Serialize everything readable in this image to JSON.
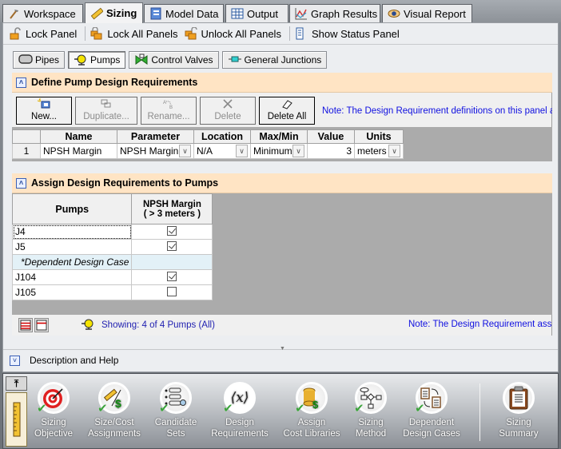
{
  "tabs": [
    {
      "label": "Workspace",
      "icon": "hammer-icon",
      "active": false
    },
    {
      "label": "Sizing",
      "icon": "ruler-icon",
      "active": true
    },
    {
      "label": "Model Data",
      "icon": "notebook-icon",
      "active": false
    },
    {
      "label": "Output",
      "icon": "table-icon",
      "active": false
    },
    {
      "label": "Graph Results",
      "icon": "graph-icon",
      "active": false
    },
    {
      "label": "Visual Report",
      "icon": "eye-icon",
      "active": false
    }
  ],
  "toolbar": {
    "lock_panel": "Lock Panel",
    "lock_all": "Lock All Panels",
    "unlock_all": "Unlock All Panels",
    "show_status": "Show Status Panel"
  },
  "subtabs": [
    {
      "label": "Pipes",
      "icon": "pipe-icon",
      "active": false
    },
    {
      "label": "Pumps",
      "icon": "pump-icon",
      "active": true
    },
    {
      "label": "Control Valves",
      "icon": "valve-icon",
      "active": false
    },
    {
      "label": "General Junctions",
      "icon": "junction-icon",
      "active": false
    }
  ],
  "define_panel": {
    "title": "Define Pump Design Requirements",
    "buttons": {
      "new": "New...",
      "duplicate": "Duplicate...",
      "rename": "Rename...",
      "delete": "Delete",
      "delete_all": "Delete All"
    },
    "note": "Note: The Design Requirement definitions on this panel are co",
    "columns": [
      "Name",
      "Parameter",
      "Location",
      "Max/Min",
      "Value",
      "Units"
    ],
    "rows": [
      {
        "index": "1",
        "name": "NPSH Margin",
        "parameter": "NPSH Margin",
        "location": "N/A",
        "maxmin": "Minimum",
        "value": "3",
        "units": "meters"
      }
    ]
  },
  "assign_panel": {
    "title": "Assign Design Requirements to Pumps",
    "col_pumps": "Pumps",
    "col_req_line1": "NPSH Margin",
    "col_req_line2": "( > 3 meters )",
    "rows": [
      {
        "name": "J4",
        "checked": true
      },
      {
        "name": "J5",
        "checked": true
      },
      {
        "name": "*Dependent Design Case",
        "section": true
      },
      {
        "name": "J104",
        "checked": true
      },
      {
        "name": "J105",
        "checked": false
      }
    ],
    "showing": "Showing: 4 of 4 Pumps (All)",
    "note": "Note: The Design Requirement assig"
  },
  "description_help": "Description and Help",
  "ribbon": {
    "items": [
      {
        "line1": "Sizing",
        "line2": "Objective",
        "icon": "target-icon",
        "done": true
      },
      {
        "line1": "Size/Cost",
        "line2": "Assignments",
        "icon": "ruler-dollar-icon",
        "done": true
      },
      {
        "line1": "Candidate",
        "line2": "Sets",
        "icon": "list-search-icon",
        "done": true
      },
      {
        "line1": "Design",
        "line2": "Requirements",
        "icon": "variable-x-icon",
        "done": true
      },
      {
        "line1": "Assign",
        "line2": "Cost Libraries",
        "icon": "database-dollar-icon",
        "done": true
      },
      {
        "line1": "Sizing",
        "line2": "Method",
        "icon": "flowchart-icon",
        "done": true
      },
      {
        "line1": "Dependent",
        "line2": "Design Cases",
        "icon": "clipboard-swap-icon",
        "done": true
      },
      {
        "line1": "Sizing",
        "line2": "Summary",
        "icon": "clipboard-icon",
        "done": false
      }
    ]
  }
}
